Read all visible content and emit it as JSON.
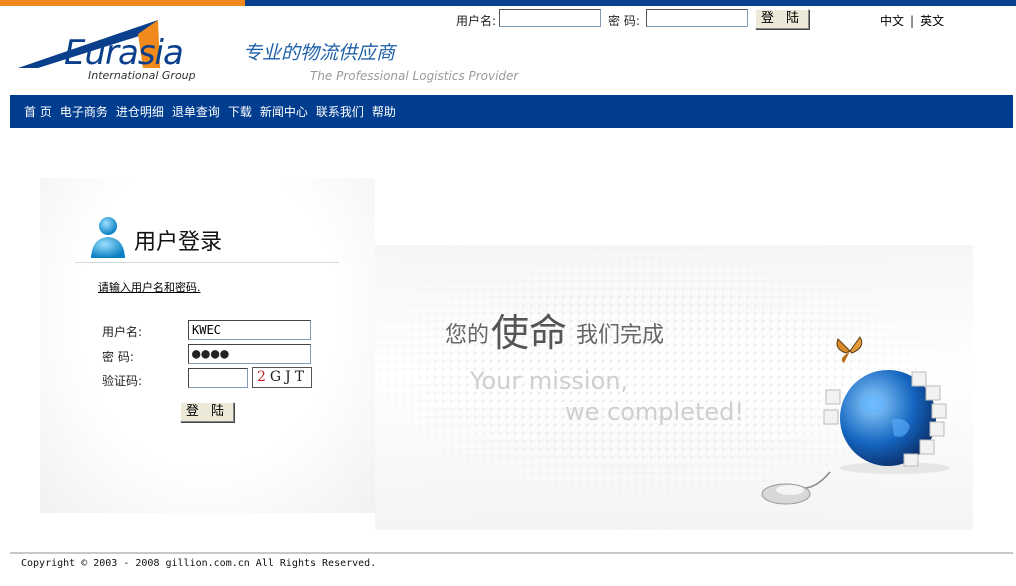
{
  "header": {
    "username_label": "用户名:",
    "password_label": "密 码:",
    "login_button": "登 陆",
    "lang_cn": "中文",
    "lang_sep": "|",
    "lang_en": "英文"
  },
  "brand": {
    "logo_text": "Eurasia",
    "logo_sub": "International Group",
    "slogan_cn": "专业的物流供应商",
    "slogan_en": "The Professional Logistics Provider"
  },
  "nav": {
    "items": [
      "首 页",
      "电子商务",
      "进仓明细",
      "退单查询",
      "下载",
      "新闻中心",
      "联系我们",
      "帮助"
    ]
  },
  "login_panel": {
    "title": "用户登录",
    "hint": "请输入用户名和密码.",
    "username_label": "用户名:",
    "username_value": "KWEC",
    "password_label": "密 码:",
    "password_value": "●●●●",
    "captcha_label": "验证码:",
    "captcha_value": "",
    "captcha_red": "2",
    "captcha_rest": "GJT",
    "submit_button": "登 陆"
  },
  "banner": {
    "mission_cn_pre": "您的",
    "mission_cn_big": "使命",
    "mission_cn_post": "我们完成",
    "mission_en_line1": "Your mission,",
    "mission_en_line2": "we completed!"
  },
  "footer": {
    "copyright": "Copyright © 2003 - 2008 gillion.com.cn All Rights Reserved."
  },
  "colors": {
    "nav_bg": "#003d8f",
    "brand_blue": "#0a3f8c",
    "accent_orange": "#f08a1c"
  }
}
